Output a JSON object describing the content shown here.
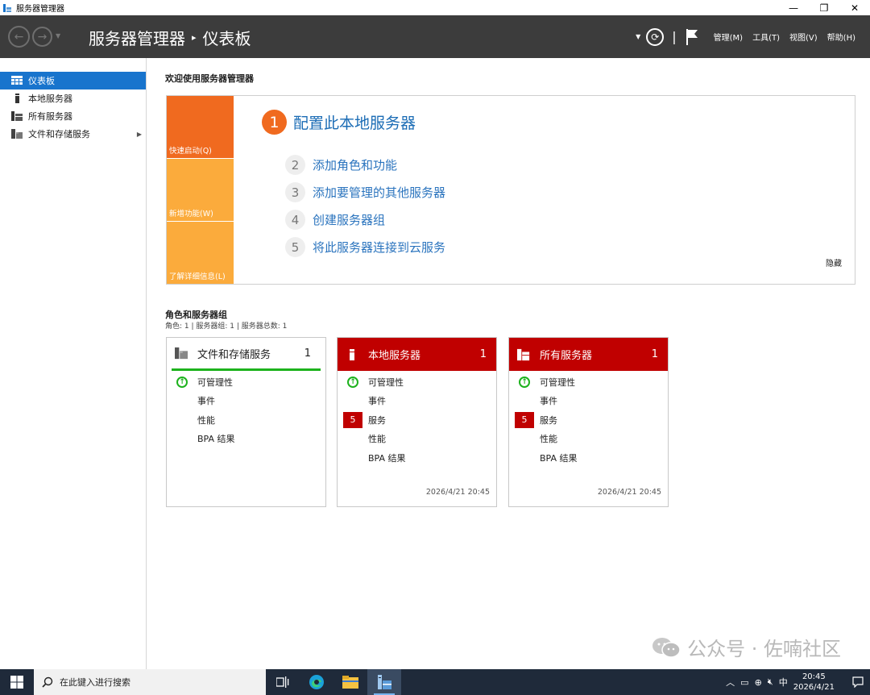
{
  "window": {
    "title": "服务器管理器",
    "controls": {
      "minimize": "—",
      "restore": "❐",
      "close": "✕"
    }
  },
  "header": {
    "breadcrumb_root": "服务器管理器",
    "breadcrumb_sep": "▸",
    "breadcrumb_page": "仪表板",
    "menus": [
      "管理(M)",
      "工具(T)",
      "视图(V)",
      "帮助(H)"
    ],
    "pipe": "|"
  },
  "sidebar": {
    "items": [
      {
        "label": "仪表板",
        "icon": "dashboard-icon",
        "active": true
      },
      {
        "label": "本地服务器",
        "icon": "server-icon",
        "active": false
      },
      {
        "label": "所有服务器",
        "icon": "servers-icon",
        "active": false
      },
      {
        "label": "文件和存储服务",
        "icon": "storage-icon",
        "active": false,
        "expandable": true
      }
    ]
  },
  "welcome": {
    "title": "欢迎使用服务器管理器",
    "quick_tabs": [
      "快速启动(Q)",
      "新增功能(W)",
      "了解详细信息(L)"
    ],
    "main_step": {
      "num": "1",
      "label": "配置此本地服务器"
    },
    "steps": [
      {
        "num": "2",
        "label": "添加角色和功能"
      },
      {
        "num": "3",
        "label": "添加要管理的其他服务器"
      },
      {
        "num": "4",
        "label": "创建服务器组"
      },
      {
        "num": "5",
        "label": "将此服务器连接到云服务"
      }
    ],
    "hide": "隐藏"
  },
  "roles": {
    "title": "角色和服务器组",
    "subtitle": "角色: 1 | 服务器组: 1 | 服务器总数: 1",
    "tiles": [
      {
        "name": "文件和存储服务",
        "count": "1",
        "style": "white",
        "rows": [
          "可管理性",
          "事件",
          "性能",
          "BPA 结果"
        ],
        "timestamp": ""
      },
      {
        "name": "本地服务器",
        "count": "1",
        "style": "red",
        "rows": [
          "可管理性",
          "事件",
          "服务",
          "性能",
          "BPA 结果"
        ],
        "badge": "5",
        "timestamp": "2026/4/21 20:45"
      },
      {
        "name": "所有服务器",
        "count": "1",
        "style": "red",
        "rows": [
          "可管理性",
          "事件",
          "服务",
          "性能",
          "BPA 结果"
        ],
        "badge": "5",
        "timestamp": "2026/4/21 20:45"
      }
    ]
  },
  "watermark": "公众号 · 佐喃社区",
  "taskbar": {
    "search_placeholder": "在此键入进行搜索",
    "ime": "中",
    "time": "20:45",
    "date": "2026/4/21"
  },
  "colors": {
    "header_bg": "#3c3c3c",
    "accent_blue": "#1874cd",
    "orange": "#f06a1f",
    "light_orange": "#fbab3c",
    "red": "#c00000",
    "green": "#1db21d",
    "taskbar_bg": "#1f2a3a"
  }
}
